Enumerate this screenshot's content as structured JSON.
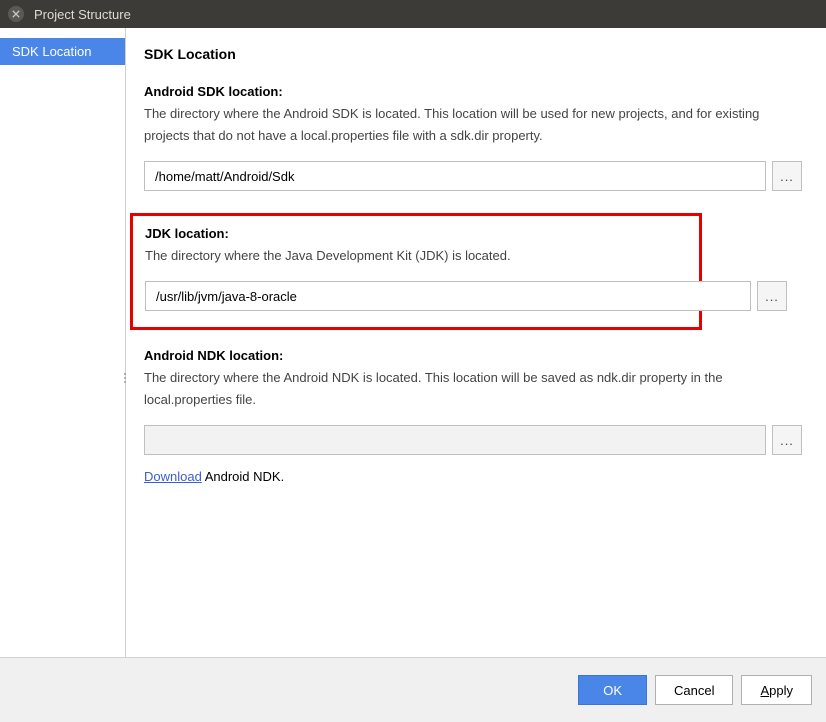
{
  "window": {
    "title": "Project Structure"
  },
  "sidebar": {
    "items": [
      {
        "label": "SDK Location",
        "selected": true
      }
    ]
  },
  "main": {
    "heading": "SDK Location",
    "sdk": {
      "label": "Android SDK location:",
      "desc": "The directory where the Android SDK is located. This location will be used for new projects, and for existing projects that do not have a local.properties file with a sdk.dir property.",
      "value": "/home/matt/Android/Sdk"
    },
    "jdk": {
      "label": "JDK location:",
      "desc": "The directory where the Java Development Kit (JDK) is located.",
      "value": "/usr/lib/jvm/java-8-oracle"
    },
    "ndk": {
      "label": "Android NDK location:",
      "desc": "The directory where the Android NDK is located. This location will be saved as ndk.dir property in the local.properties file.",
      "value": "",
      "download_link": "Download",
      "download_suffix": " Android NDK."
    }
  },
  "footer": {
    "ok": "OK",
    "cancel": "Cancel",
    "apply": "Apply"
  },
  "browse_label": "..."
}
